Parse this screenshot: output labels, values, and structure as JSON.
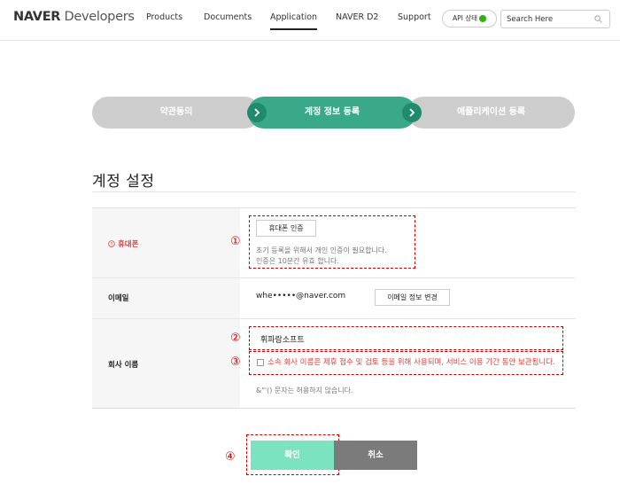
{
  "header": {
    "logo_bold": "NAVER",
    "logo_light": "Developers",
    "nav": [
      "Products",
      "Documents",
      "Application",
      "NAVER D2",
      "Support"
    ],
    "active_nav": "Application",
    "api_status_label": "API 상태",
    "api_status_color": "#2db400",
    "search_placeholder": "Search Here"
  },
  "steps": [
    {
      "label": "약관동의",
      "state": "inactive"
    },
    {
      "label": "계정 정보 등록",
      "state": "active"
    },
    {
      "label": "애플리케이션 등록",
      "state": "inactive"
    }
  ],
  "section_title": "계정 설정",
  "form": {
    "phone": {
      "label": "휴대폰",
      "required_icon": "alert-circle-icon",
      "verify_button": "휴대폰 인증",
      "note_line1": "초기 등록을 위해서 개인 인증이 필요합니다.",
      "note_line2": "인증은 10분간 유효 합니다."
    },
    "email": {
      "label": "이메일",
      "value": "whe•••••@naver.com",
      "change_button": "이메일 정보 변경"
    },
    "company": {
      "label": "회사 이름",
      "value": "휘파람소프트",
      "consent_text": "소속 회사 이름은 제휴 접수 및 검토 등을 위해 사용되며, 서비스 이용 기간 동안 보관됩니다.",
      "consent_checked": false,
      "note": "&\"'() 문자는 허용하지 않습니다."
    }
  },
  "annotations": [
    "①",
    "②",
    "③",
    "④"
  ],
  "buttons": {
    "confirm": "확인",
    "cancel": "취소"
  },
  "colors": {
    "accent_green": "#3aa98a",
    "confirm_green": "#7ce3c0",
    "error_red": "#e2403a",
    "annotation_red": "#cc0000"
  }
}
